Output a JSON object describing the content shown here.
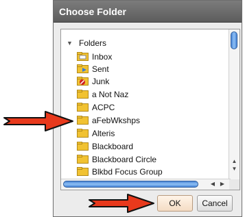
{
  "dialog": {
    "title": "Choose Folder",
    "root": {
      "label": "Folders",
      "expanded": true
    },
    "folders": [
      {
        "label": "Inbox",
        "icon": "inbox-folder-icon"
      },
      {
        "label": "Sent",
        "icon": "sent-folder-icon"
      },
      {
        "label": "Junk",
        "icon": "junk-folder-icon"
      },
      {
        "label": "a Not Naz",
        "icon": "folder-icon"
      },
      {
        "label": "ACPC",
        "icon": "folder-icon"
      },
      {
        "label": "aFebWkshps",
        "icon": "folder-icon"
      },
      {
        "label": "Alteris",
        "icon": "folder-icon"
      },
      {
        "label": "Blackboard",
        "icon": "folder-icon"
      },
      {
        "label": "Blackboard Circle",
        "icon": "folder-icon"
      },
      {
        "label": "Blkbd Focus Group",
        "icon": "folder-icon"
      }
    ],
    "buttons": {
      "ok": "OK",
      "cancel": "Cancel"
    }
  },
  "colors": {
    "arrow_fill": "#e8391c",
    "arrow_stroke": "#111111",
    "folder": "#f1c232",
    "title_bg": "#6a6a6a",
    "scroll_blue": "#4a86d8"
  }
}
